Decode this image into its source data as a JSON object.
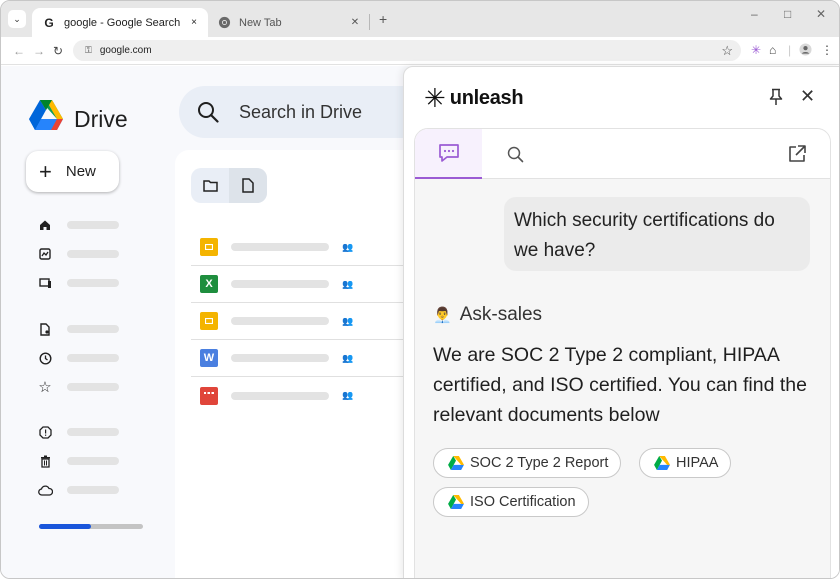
{
  "browser": {
    "tabs": [
      {
        "title": "google - Google Search",
        "close": "×",
        "active": true
      },
      {
        "title": "New Tab",
        "close": "✕",
        "active": false
      }
    ],
    "new_tab": "+",
    "address": "google.com",
    "window_controls": [
      "–",
      "□",
      "✕"
    ]
  },
  "drive": {
    "title": "Drive",
    "search_placeholder": "Search in Drive",
    "new_button": {
      "icon": "+",
      "label": "New"
    },
    "sidebar_icons": [
      "home-icon",
      "activity-icon",
      "workspaces-icon",
      "shared-icon",
      "recent-icon",
      "starred-icon",
      "spam-icon",
      "trash-icon",
      "storage-icon"
    ],
    "storage_used": 0.5,
    "files": [
      {
        "type": "slides",
        "color": "#f4b400",
        "glyph": ""
      },
      {
        "type": "sheets",
        "color": "#1e8e3e",
        "glyph": "X"
      },
      {
        "type": "slides",
        "color": "#f4b400",
        "glyph": ""
      },
      {
        "type": "docs",
        "color": "#4a7fe0",
        "glyph": "W"
      },
      {
        "type": "video",
        "color": "#e0453a",
        "glyph": ""
      }
    ]
  },
  "unleash": {
    "brand": "unleash",
    "brand_mark": "✳",
    "close": "✕",
    "user_message": "Which security certifications do we have?",
    "bot_emoji": "👨‍💼",
    "bot_name": "Ask-sales",
    "answer": "We are SOC 2 Type 2 compliant, HIPAA certified, and ISO certified. You can find the relevant documents below",
    "chips": [
      "SOC 2 Type 2 Report",
      "HIPAA",
      "ISO Certification"
    ]
  }
}
